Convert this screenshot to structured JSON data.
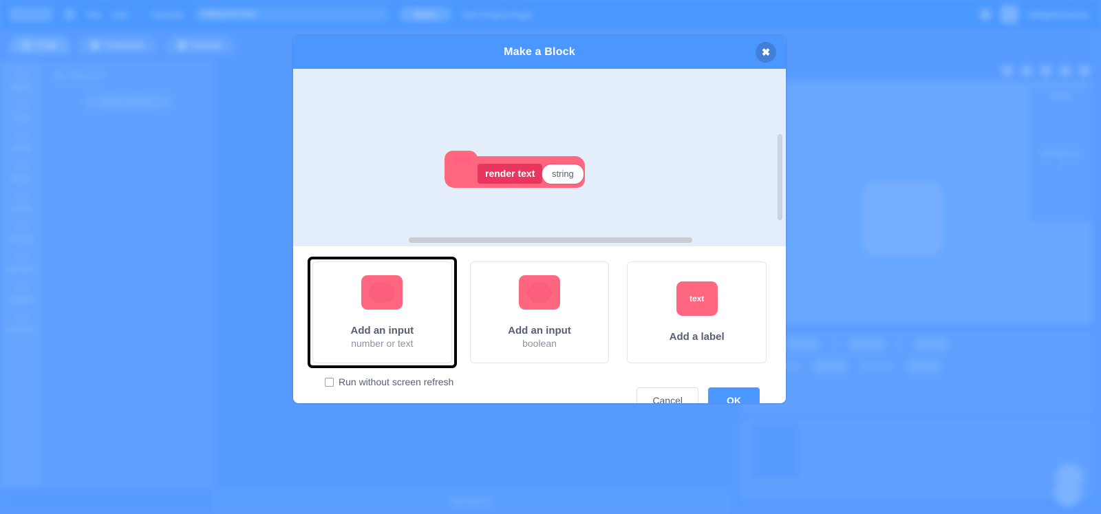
{
  "backdrop": {
    "menu": {
      "logo": "scratch-logo",
      "items": [
        "File",
        "Edit"
      ],
      "tutorials": "Tutorials",
      "project_title": "Editing the text",
      "share": "Share",
      "see_project_page": "See Project Page",
      "username": "WillightCassidy"
    },
    "tabs": [
      {
        "label": "Code",
        "icon": "code-icon",
        "active": true
      },
      {
        "label": "Costumes",
        "icon": "brush-icon",
        "active": false
      },
      {
        "label": "Sounds",
        "icon": "sound-icon",
        "active": false
      }
    ],
    "categories": [
      {
        "label": "Motion",
        "color": "#4c97ff"
      },
      {
        "label": "Looks",
        "color": "#9966ff"
      },
      {
        "label": "Sound",
        "color": "#cf63cf"
      },
      {
        "label": "Events",
        "color": "#ffbf00"
      },
      {
        "label": "Control",
        "color": "#ffab19"
      },
      {
        "label": "Sensing",
        "color": "#5cb1d6"
      },
      {
        "label": "Operators",
        "color": "#59c059"
      },
      {
        "label": "Variables",
        "color": "#ff8c1a"
      },
      {
        "label": "My Blocks",
        "color": "#ff6680"
      }
    ],
    "palette_header": "My Blocks",
    "palette_button": "Make a Block",
    "backpack_label": "Backpack",
    "sprite_info": {
      "sprite_label": "Sprite",
      "x_label": "x",
      "x_value": "0",
      "y_label": "y",
      "y_value": "0",
      "show_label": "Show",
      "size_label": "Size",
      "size_value": "100",
      "direction_label": "Direction",
      "direction_value": "90"
    },
    "stage_panel": {
      "stage_label": "Stage",
      "backdrops_label": "Backdrops",
      "backdrops_count": "1"
    }
  },
  "modal": {
    "title": "Make a Block",
    "close_icon": "close-icon",
    "block_preview": {
      "label": "render text",
      "input_value": "string",
      "block_color": "#ff6680",
      "label_color": "#e9365f"
    },
    "options": [
      {
        "icon": "round-input-icon",
        "title": "Add an input",
        "subtitle": "number or text",
        "focused": true
      },
      {
        "icon": "boolean-input-icon",
        "title": "Add an input",
        "subtitle": "boolean",
        "focused": false
      },
      {
        "icon": "text-label-icon",
        "icon_text": "text",
        "title": "Add a label",
        "subtitle": "",
        "focused": false
      }
    ],
    "checkbox": {
      "label": "Run without screen refresh",
      "checked": false
    },
    "buttons": {
      "cancel": "Cancel",
      "ok": "OK"
    },
    "colors": {
      "header": "#4c97ff",
      "accent": "#4c97ff",
      "block": "#ff6680"
    }
  }
}
